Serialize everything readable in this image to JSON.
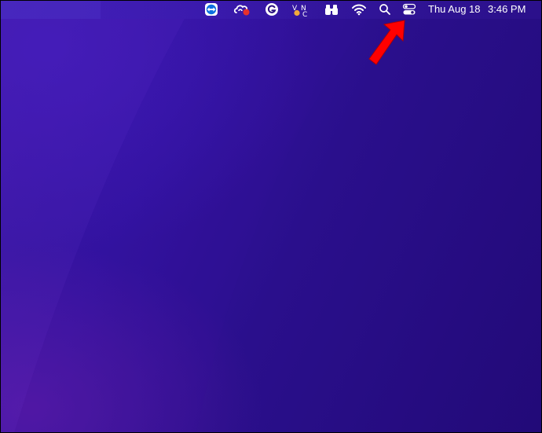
{
  "menubar": {
    "status_items": [
      {
        "icon": "teamviewer-icon"
      },
      {
        "icon": "creative-cloud-icon"
      },
      {
        "icon": "grammarly-icon"
      },
      {
        "icon": "vnc-icon"
      },
      {
        "icon": "binoculars-icon"
      },
      {
        "icon": "wifi-icon"
      },
      {
        "icon": "search-icon"
      },
      {
        "icon": "control-center-icon"
      }
    ],
    "date": "Thu Aug 18",
    "time": "3:46 PM"
  },
  "annotation": {
    "icon": "red-arrow-icon",
    "color": "#ff0000",
    "points_to": "control-center-icon"
  },
  "colors": {
    "desktop_background": "#2a0f80",
    "menubar_text": "#ffffff"
  }
}
